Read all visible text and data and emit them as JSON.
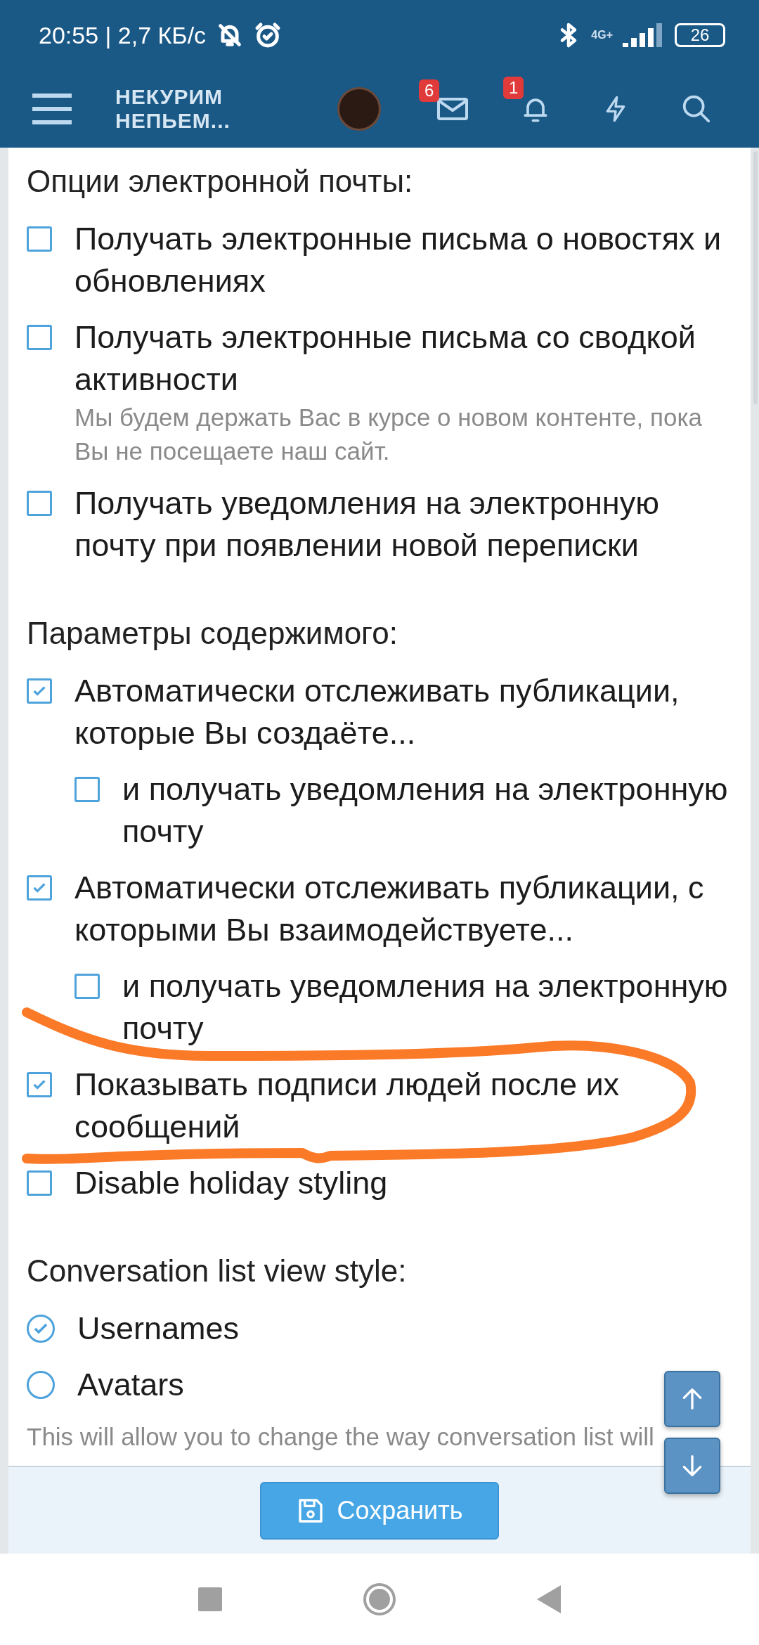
{
  "status_bar": {
    "time": "20:55 | 2,7 КБ/с",
    "network": "4G+",
    "battery": "26"
  },
  "header": {
    "logo_lines": [
      "НЕКУРИМ",
      "НЕПЬЕМ..."
    ],
    "messages_badge": "6",
    "alerts_badge": "1"
  },
  "sections": [
    {
      "title": "Опции электронной почты:",
      "items": [
        {
          "label": "Получать электронные письма о новостях и обновлениях",
          "checked": false
        },
        {
          "label": "Получать электронные письма со сводкой активности",
          "checked": false,
          "hint": "Мы будем держать Вас в курсе о новом контенте, пока Вы не посещаете наш сайт."
        },
        {
          "label": "Получать уведомления на электронную почту при появлении новой переписки",
          "checked": false
        }
      ]
    },
    {
      "title": "Параметры содержимого:",
      "items": [
        {
          "label": "Автоматически отслеживать публикации, которые Вы создаёте...",
          "checked": true,
          "children": [
            {
              "label": "и получать уведомления на электронную почту",
              "checked": false
            }
          ]
        },
        {
          "label": "Автоматически отслеживать публикации, с которыми Вы взаимодействуете...",
          "checked": true,
          "children": [
            {
              "label": "и получать уведомления на электронную почту",
              "checked": false
            }
          ]
        },
        {
          "label": "Показывать подписи людей после их сообщений",
          "checked": true
        },
        {
          "label": "Disable holiday styling",
          "checked": false
        }
      ]
    }
  ],
  "radio_group": {
    "title": "Conversation list view style:",
    "options": [
      {
        "label": "Usernames",
        "selected": true
      },
      {
        "label": "Avatars",
        "selected": false
      }
    ],
    "hint": "This will allow you to change the way conversation list will"
  },
  "save_button": "Сохранить"
}
